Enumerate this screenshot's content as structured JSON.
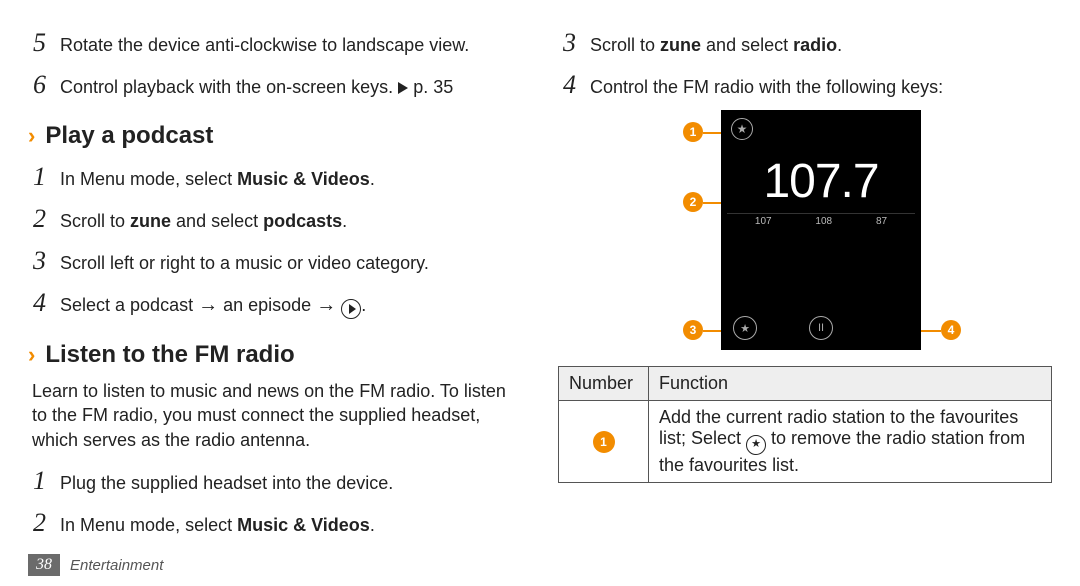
{
  "left": {
    "step5": {
      "num": "5",
      "text_a": "Rotate the device anti-clockwise to landscape view."
    },
    "step6": {
      "num": "6",
      "text_a": "Control playback with the on-screen keys. ",
      "pref": "p. 35"
    },
    "h_podcast": "Play a podcast",
    "p1": {
      "num": "1",
      "pre": "In Menu mode, select ",
      "bold": "Music & Videos",
      "post": "."
    },
    "p2": {
      "num": "2",
      "pre": "Scroll to ",
      "b1": "zune",
      "mid": " and select ",
      "b2": "podcasts",
      "post": "."
    },
    "p3": {
      "num": "3",
      "text": "Scroll left or right to a music or video category."
    },
    "p4": {
      "num": "4",
      "pre": "Select a podcast ",
      "arrow": "→",
      "mid": " an episode ",
      "post": "."
    },
    "h_fm": "Listen to the FM radio",
    "fm_intro": "Learn to listen to music and news on the FM radio. To listen to the FM radio, you must connect the supplied headset, which serves as the radio antenna.",
    "f1": {
      "num": "1",
      "text": "Plug the supplied headset into the device."
    },
    "f2": {
      "num": "2",
      "pre": "In Menu mode, select ",
      "bold": "Music & Videos",
      "post": "."
    }
  },
  "right": {
    "r3": {
      "num": "3",
      "pre": "Scroll to ",
      "b1": "zune",
      "mid": " and select ",
      "b2": "radio",
      "post": "."
    },
    "r4": {
      "num": "4",
      "text": "Control the FM radio with the following keys:"
    },
    "device": {
      "freq": "107.7",
      "ticks": [
        "107",
        "108",
        "87"
      ],
      "star": "★",
      "pause": "II"
    },
    "callouts": {
      "c1": "1",
      "c2": "2",
      "c3": "3",
      "c4": "4"
    },
    "table": {
      "h_num": "Number",
      "h_func": "Function",
      "row1_num": "1",
      "row1_a": "Add the current radio station to the favourites list; Select ",
      "row1_b": " to remove the radio station from the favourites list."
    }
  },
  "footer": {
    "page": "38",
    "section": "Entertainment"
  }
}
